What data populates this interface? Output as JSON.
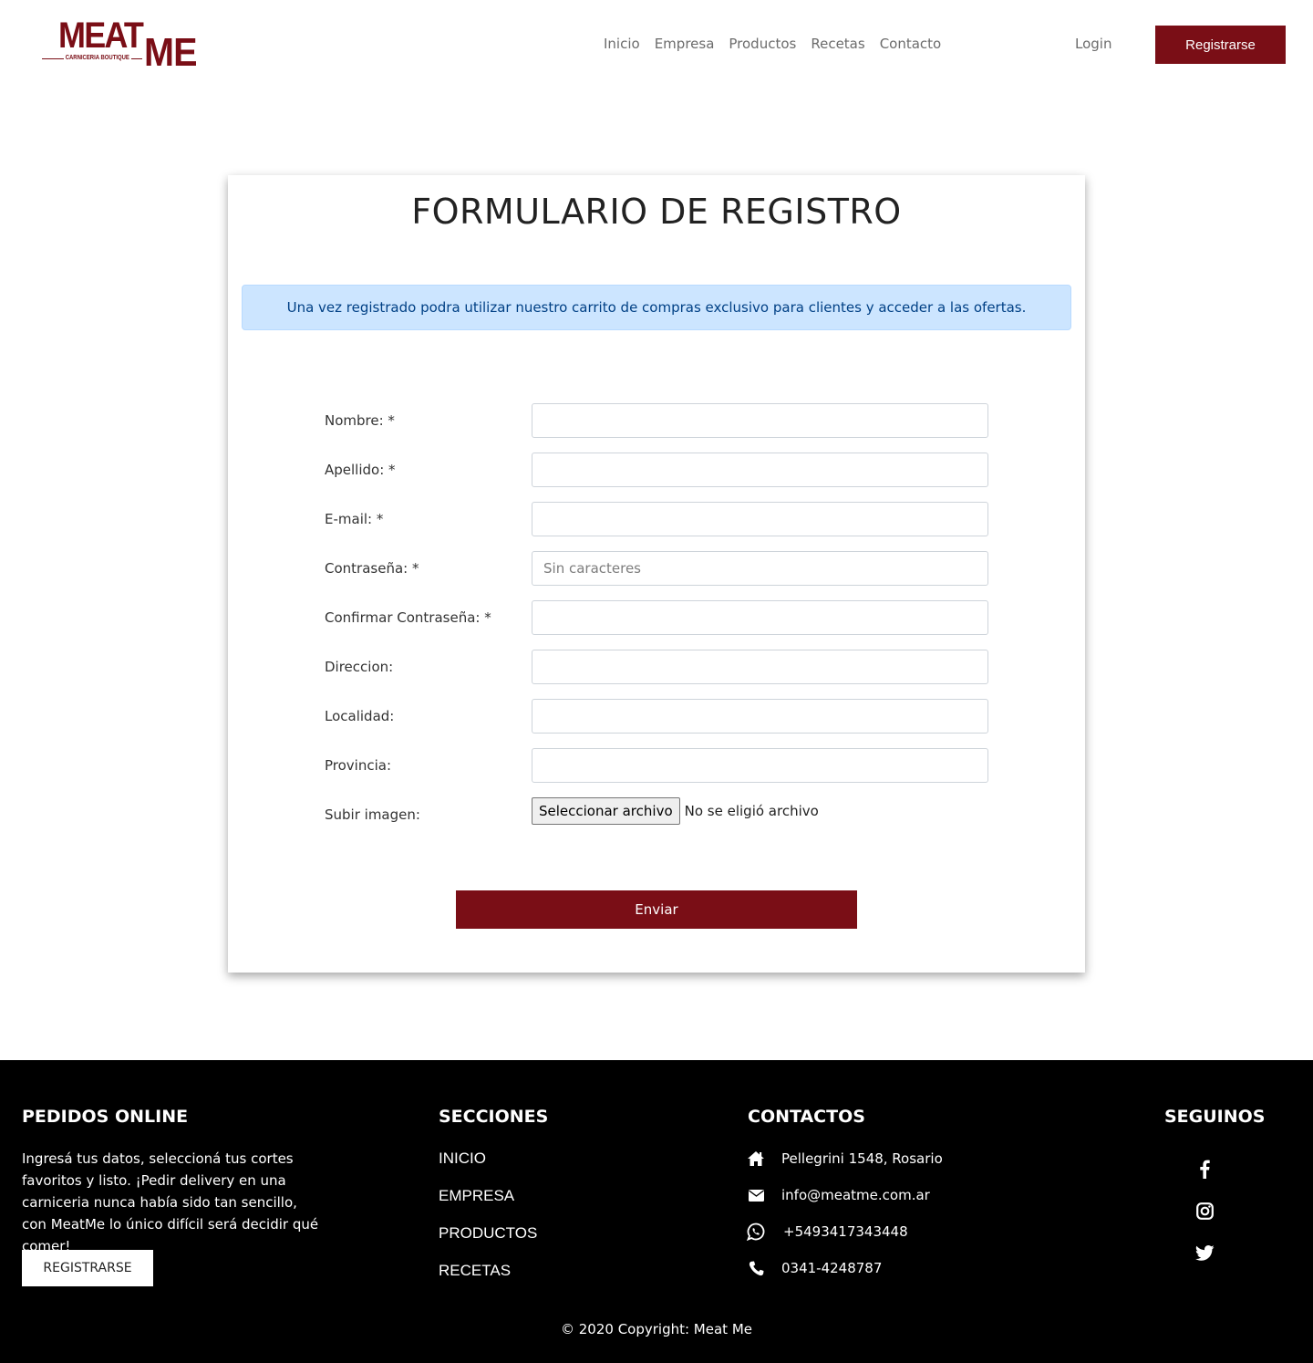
{
  "brand": {
    "logo_word_1": "MEAT",
    "logo_word_2": "ME",
    "logo_tagline": "CARNICERIA BOUTIQUE",
    "color": "#7a0e16"
  },
  "nav": {
    "links": [
      "Inicio",
      "Empresa",
      "Productos",
      "Recetas",
      "Contacto"
    ],
    "login": "Login",
    "register": "Registrarse"
  },
  "form": {
    "title": "FORMULARIO DE REGISTRO",
    "alert": "Una vez registrado podra utilizar nuestro carrito de compras exclusivo para clientes y acceder a las ofertas.",
    "fields": [
      {
        "label": "Nombre: *",
        "value": "",
        "placeholder": ""
      },
      {
        "label": "Apellido: *",
        "value": "",
        "placeholder": ""
      },
      {
        "label": "E-mail: *",
        "value": "",
        "placeholder": ""
      },
      {
        "label": "Contraseña: *",
        "value": "",
        "placeholder": "Sin caracteres"
      },
      {
        "label": "Confirmar Contraseña: *",
        "value": "",
        "placeholder": ""
      },
      {
        "label": "Direccion:",
        "value": "",
        "placeholder": ""
      },
      {
        "label": "Localidad:",
        "value": "",
        "placeholder": ""
      },
      {
        "label": "Provincia:",
        "value": "",
        "placeholder": ""
      }
    ],
    "file": {
      "label": "Subir imagen:",
      "button": "Seleccionar archivo",
      "status": "No se eligió archivo"
    },
    "submit": "Enviar"
  },
  "footer": {
    "orders": {
      "heading": "PEDIDOS ONLINE",
      "text": "Ingresá tus datos, seleccioná tus cortes favoritos y listo. ¡Pedir delivery en una carniceria nunca había sido tan sencillo, con MeatMe lo único difícil será decidir qué comer!",
      "button": "REGISTRARSE"
    },
    "sections": {
      "heading": "SECCIONES",
      "links": [
        "INICIO",
        "EMPRESA",
        "PRODUCTOS",
        "RECETAS"
      ]
    },
    "contacts": {
      "heading": "CONTACTOS",
      "items": [
        {
          "icon": "home-icon",
          "text": "Pellegrini 1548, Rosario"
        },
        {
          "icon": "envelope-icon",
          "text": "info@meatme.com.ar"
        },
        {
          "icon": "whatsapp-icon",
          "text": "+5493417343448"
        },
        {
          "icon": "phone-icon",
          "text": "0341-4248787"
        }
      ]
    },
    "social": {
      "heading": "SEGUINOS",
      "icons": [
        "facebook-icon",
        "instagram-icon",
        "twitter-icon"
      ]
    },
    "copyright": "© 2020 Copyright: Meat Me"
  }
}
